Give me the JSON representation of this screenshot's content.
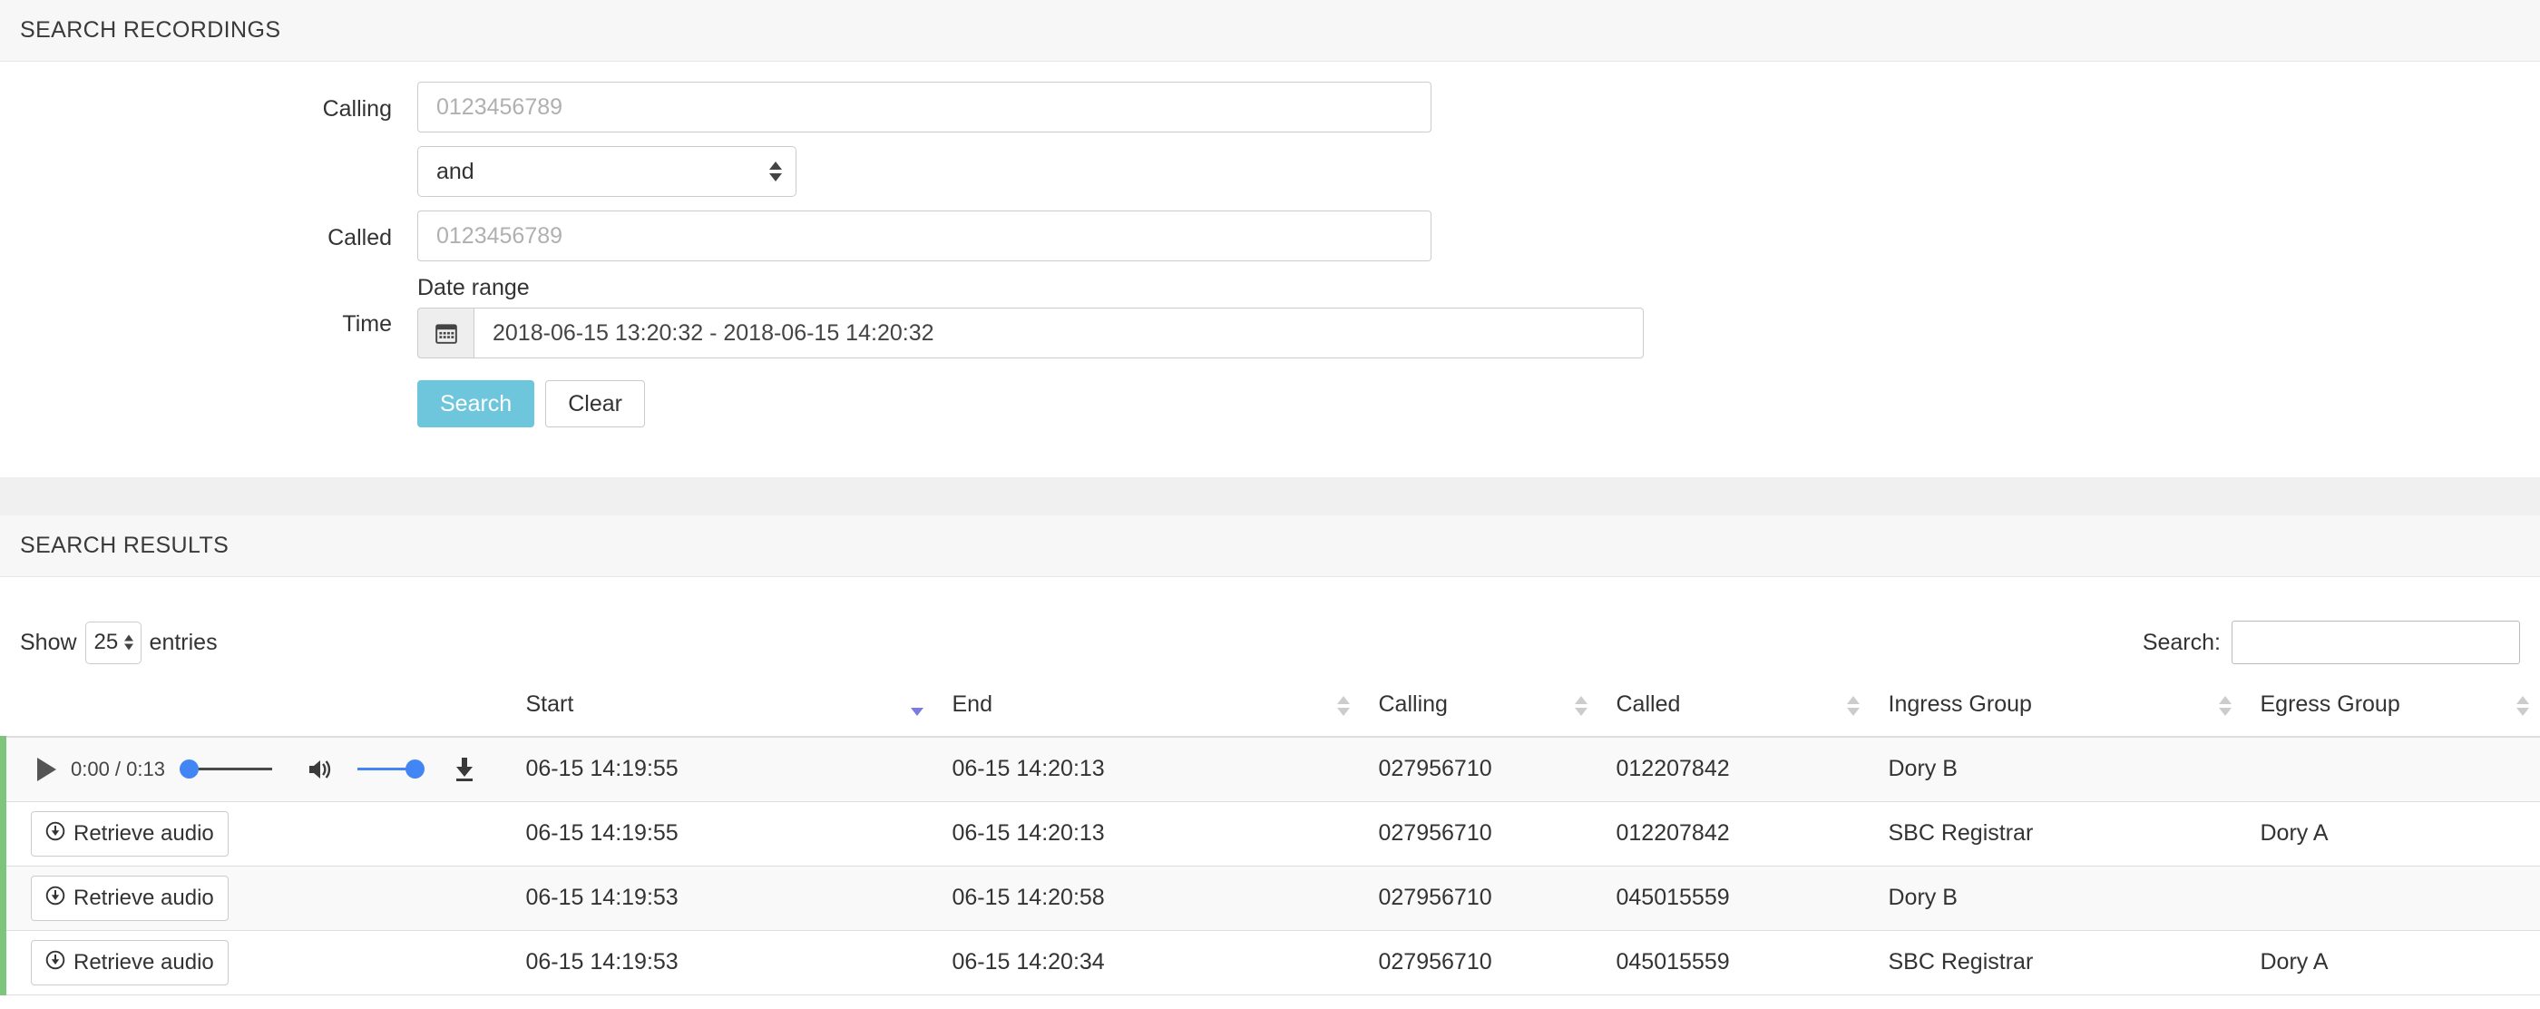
{
  "search_panel": {
    "title": "SEARCH RECORDINGS",
    "calling_label": "Calling",
    "calling_placeholder": "0123456789",
    "calling_value": "",
    "operator_value": "and",
    "called_label": "Called",
    "called_placeholder": "0123456789",
    "called_value": "",
    "time_label": "Time",
    "daterange_label": "Date range",
    "daterange_value": "2018-06-15 13:20:32 - 2018-06-15 14:20:32",
    "calendar_icon": "calendar-icon",
    "search_button": "Search",
    "clear_button": "Clear",
    "primary_color": "#6ec6dd"
  },
  "results_panel": {
    "title": "SEARCH RESULTS",
    "show_label": "Show",
    "entries_label": "entries",
    "page_length": "25",
    "filter_label": "Search:",
    "filter_value": "",
    "filter_placeholder": "",
    "row_marker_color": "#7dc57d",
    "sort_active_color": "#7a7ae0",
    "columns": [
      {
        "key": "audio",
        "label": "",
        "sortable": false,
        "sort": "none"
      },
      {
        "key": "start",
        "label": "Start",
        "sortable": true,
        "sort": "desc"
      },
      {
        "key": "end",
        "label": "End",
        "sortable": true,
        "sort": "none"
      },
      {
        "key": "calling",
        "label": "Calling",
        "sortable": true,
        "sort": "none"
      },
      {
        "key": "called",
        "label": "Called",
        "sortable": true,
        "sort": "none"
      },
      {
        "key": "ingress",
        "label": "Ingress Group",
        "sortable": true,
        "sort": "none"
      },
      {
        "key": "egress",
        "label": "Egress Group",
        "sortable": true,
        "sort": "none"
      }
    ],
    "retrieve_button_label": "Retrieve audio",
    "retrieve_button_icon": "circle-arrow-down-icon",
    "player": {
      "play_icon": "play-icon",
      "time_display": "0:00 / 0:13",
      "current_time": "0:00",
      "duration": "0:13",
      "progress_percent": 0,
      "volume_icon": "volume-high-icon",
      "volume_percent": 100,
      "download_icon": "download-icon",
      "accent_color": "#4285f4"
    },
    "rows": [
      {
        "audio": "player",
        "start": "06-15 14:19:55",
        "end": "06-15 14:20:13",
        "calling": "027956710",
        "called": "012207842",
        "ingress": "Dory B",
        "egress": ""
      },
      {
        "audio": "retrieve",
        "start": "06-15 14:19:55",
        "end": "06-15 14:20:13",
        "calling": "027956710",
        "called": "012207842",
        "ingress": "SBC Registrar",
        "egress": "Dory A"
      },
      {
        "audio": "retrieve",
        "start": "06-15 14:19:53",
        "end": "06-15 14:20:58",
        "calling": "027956710",
        "called": "045015559",
        "ingress": "Dory B",
        "egress": ""
      },
      {
        "audio": "retrieve",
        "start": "06-15 14:19:53",
        "end": "06-15 14:20:34",
        "calling": "027956710",
        "called": "045015559",
        "ingress": "SBC Registrar",
        "egress": "Dory A"
      }
    ]
  }
}
